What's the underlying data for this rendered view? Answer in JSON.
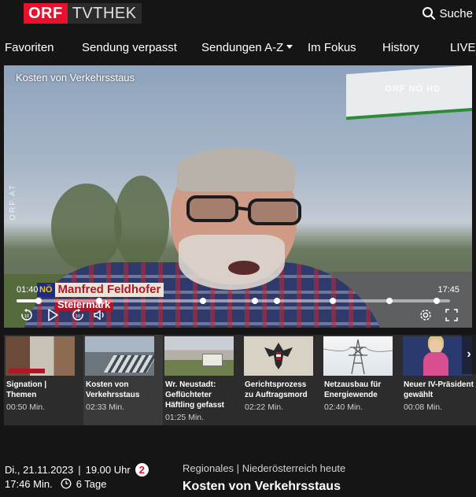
{
  "header": {
    "logo_orf": "ORF",
    "logo_tvthek": "TVTHEK",
    "search_label": "Suche",
    "search_icon": "search-icon"
  },
  "nav": {
    "items": [
      "Favoriten",
      "Sendung verpasst",
      "Sendungen A-Z",
      "Im Fokus",
      "History",
      "LIVE"
    ]
  },
  "player": {
    "title": "Kosten von Verkehrsstaus",
    "watermark": "ORF NÖ HD",
    "watermark_side": "ORF.AT",
    "lower_third": {
      "state": "NÖ",
      "name": "Manfred Feldhofer",
      "place": "Steiermark"
    },
    "time_current": "01:40",
    "time_total": "17:45",
    "progress_fraction": 0.05,
    "chapter_fractions": [
      0.05,
      0.19,
      0.43,
      0.55,
      0.6,
      0.73,
      0.86,
      0.97
    ],
    "controls": [
      "replay-10-icon",
      "play-icon",
      "forward-10-icon",
      "volume-icon",
      "settings-icon",
      "fullscreen-icon"
    ]
  },
  "chapters": [
    {
      "title": "Signation | Themen",
      "duration": "00:50 Min.",
      "active": false
    },
    {
      "title": "Kosten von Verkehrsstaus",
      "duration": "02:33 Min.",
      "active": true
    },
    {
      "title": "Wr. Neustadt: Geflüchteter Häftling gefasst",
      "duration": "01:25 Min.",
      "active": false
    },
    {
      "title": "Gerichtsprozess zu Auftragsmord",
      "duration": "02:22 Min.",
      "active": false
    },
    {
      "title": "Netzausbau für Energiewende",
      "duration": "02:40 Min.",
      "active": false
    },
    {
      "title": "Neuer IV-Präsident gewählt",
      "duration": "00:08 Min.",
      "active": false
    }
  ],
  "info": {
    "date": "Di., 21.11.2023",
    "separator": "|",
    "time": "19.00 Uhr",
    "channel_badge": "2",
    "duration": "17:46 Min.",
    "availability": "6 Tage",
    "category": "Regionales",
    "show": "Niederösterreich heute",
    "title": "Kosten von Verkehrsstaus"
  },
  "colors": {
    "orf_red": "#e8112d",
    "background": "#151515",
    "strip_background": "#2c2c2c",
    "lower_third_red": "#b3142a"
  }
}
